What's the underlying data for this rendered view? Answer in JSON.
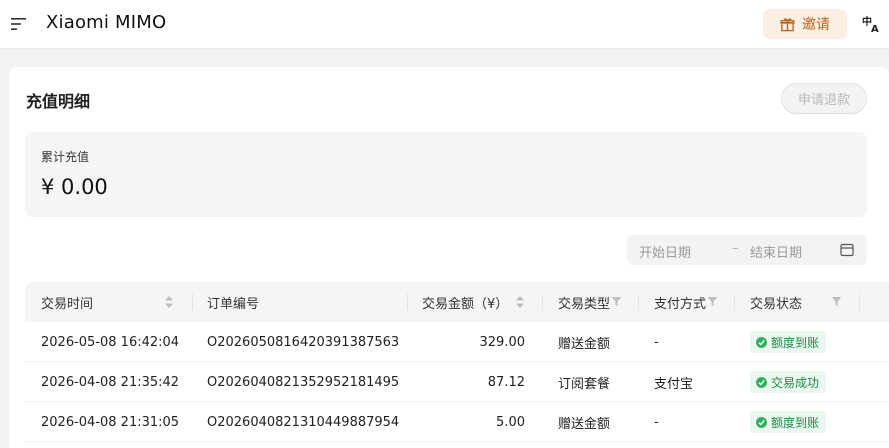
{
  "header": {
    "brand": "Xiaomi MIMO",
    "invite_label": "邀请",
    "icons": {
      "menu": "menu-lines-icon",
      "gift": "gift-icon",
      "language": "translate-icon"
    }
  },
  "page": {
    "title": "充值明细",
    "refund_button": "申请退款"
  },
  "summary": {
    "label": "累计充值",
    "value": "¥ 0.00"
  },
  "filters": {
    "start_placeholder": "开始日期",
    "separator": "–",
    "end_placeholder": "结束日期"
  },
  "table": {
    "columns": [
      "交易时间",
      "订单编号",
      "交易金额（¥）",
      "交易类型",
      "支付方式",
      "交易状态"
    ],
    "rows": [
      {
        "time": "2026-05-08 16:42:04",
        "order": "O2026050816420391387563",
        "amount": "329.00",
        "type": "赠送金额",
        "payment": "-",
        "status": "额度到账"
      },
      {
        "time": "2026-04-08 21:35:42",
        "order": "O2026040821352952181495",
        "amount": "87.12",
        "type": "订阅套餐",
        "payment": "支付宝",
        "status": "交易成功"
      },
      {
        "time": "2026-04-08 21:31:05",
        "order": "O2026040821310449887954",
        "amount": "5.00",
        "type": "赠送金额",
        "payment": "-",
        "status": "额度到账"
      }
    ]
  },
  "colors": {
    "accent": "#b8631c",
    "invite_bg": "#fbeee3",
    "status_green": "#1c8a45",
    "status_bg": "#ebf8ef"
  }
}
